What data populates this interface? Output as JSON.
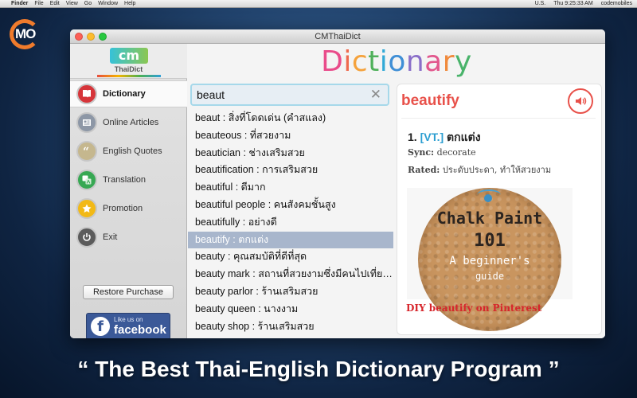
{
  "menubar": {
    "app": "Finder",
    "menus": [
      "File",
      "Edit",
      "View",
      "Go",
      "Window",
      "Help"
    ],
    "status_country": "U.S.",
    "clock": "Thu 9:25:33 AM",
    "user": "codemobiles"
  },
  "corner_logo": {
    "text": "MO"
  },
  "window": {
    "title": "CMThaiDict",
    "brand": {
      "mark": "cm",
      "name": "ThaiDict"
    }
  },
  "sidebar": {
    "items": [
      {
        "label": "Dictionary",
        "icon": "book-icon",
        "color": "#d6353a"
      },
      {
        "label": "Online Articles",
        "icon": "newspaper-icon",
        "color": "#8d97a6"
      },
      {
        "label": "English Quotes",
        "icon": "quote-icon",
        "color": "#c5b78e"
      },
      {
        "label": "Translation",
        "icon": "translate-icon",
        "color": "#37a853"
      },
      {
        "label": "Promotion",
        "icon": "star-icon",
        "color": "#f2b916"
      },
      {
        "label": "Exit",
        "icon": "power-icon",
        "color": "#5b5b5b"
      }
    ],
    "restore_label": "Restore Purchase",
    "facebook": {
      "like": "Like us on",
      "name": "facebook"
    }
  },
  "main": {
    "heading_letters": [
      {
        "ch": "D",
        "color": "#e94b8a"
      },
      {
        "ch": "i",
        "color": "#ef6a4e"
      },
      {
        "ch": "c",
        "color": "#f5a23c"
      },
      {
        "ch": "t",
        "color": "#4fb05a"
      },
      {
        "ch": "i",
        "color": "#32a9d6"
      },
      {
        "ch": "o",
        "color": "#3f8fd6"
      },
      {
        "ch": "n",
        "color": "#8a6fc9"
      },
      {
        "ch": "a",
        "color": "#e2578d"
      },
      {
        "ch": "r",
        "color": "#f08a3d"
      },
      {
        "ch": "y",
        "color": "#49b36a"
      }
    ],
    "search": {
      "value": "beaut",
      "clear_glyph": "✕"
    },
    "results": [
      "beaut : สิ่งที่โดดเด่น (คำสแลง)",
      "beauteous : ที่สวยงาม",
      "beautician : ช่างเสริมสวย",
      "beautification : การเสริมสวย",
      "beautiful : ดีมาก",
      "beautiful people : คนสังคมชั้นสูง",
      "beautifully : อย่างดี",
      "beautify : ตกแต่ง",
      "beauty : คุณสมบัติที่ดีที่สุด",
      "beauty mark : สถานที่สวยงามซึ่งมีคนไปเที่ยวมาก",
      "beauty parlor : ร้านเสริมสวย",
      "beauty queen : นางงาม",
      "beauty shop : ร้านเสริมสวย"
    ],
    "selected_index": 7,
    "detail": {
      "word": "beautify",
      "def_num": "1.",
      "pos": "[VT.]",
      "meaning": "ตกแต่ง",
      "sync_label": "Sync:",
      "sync_value": "decorate",
      "rated_label": "Rated:",
      "rated_value": "ประดับประดา, ทำให้สวยงาม",
      "image_lines": [
        "Chalk Paint",
        "101",
        "A beginner's",
        "guide"
      ],
      "link_text": "DIY beautify on Pinterest"
    }
  },
  "tagline": "“ The Best Thai-English Dictionary Program ”"
}
